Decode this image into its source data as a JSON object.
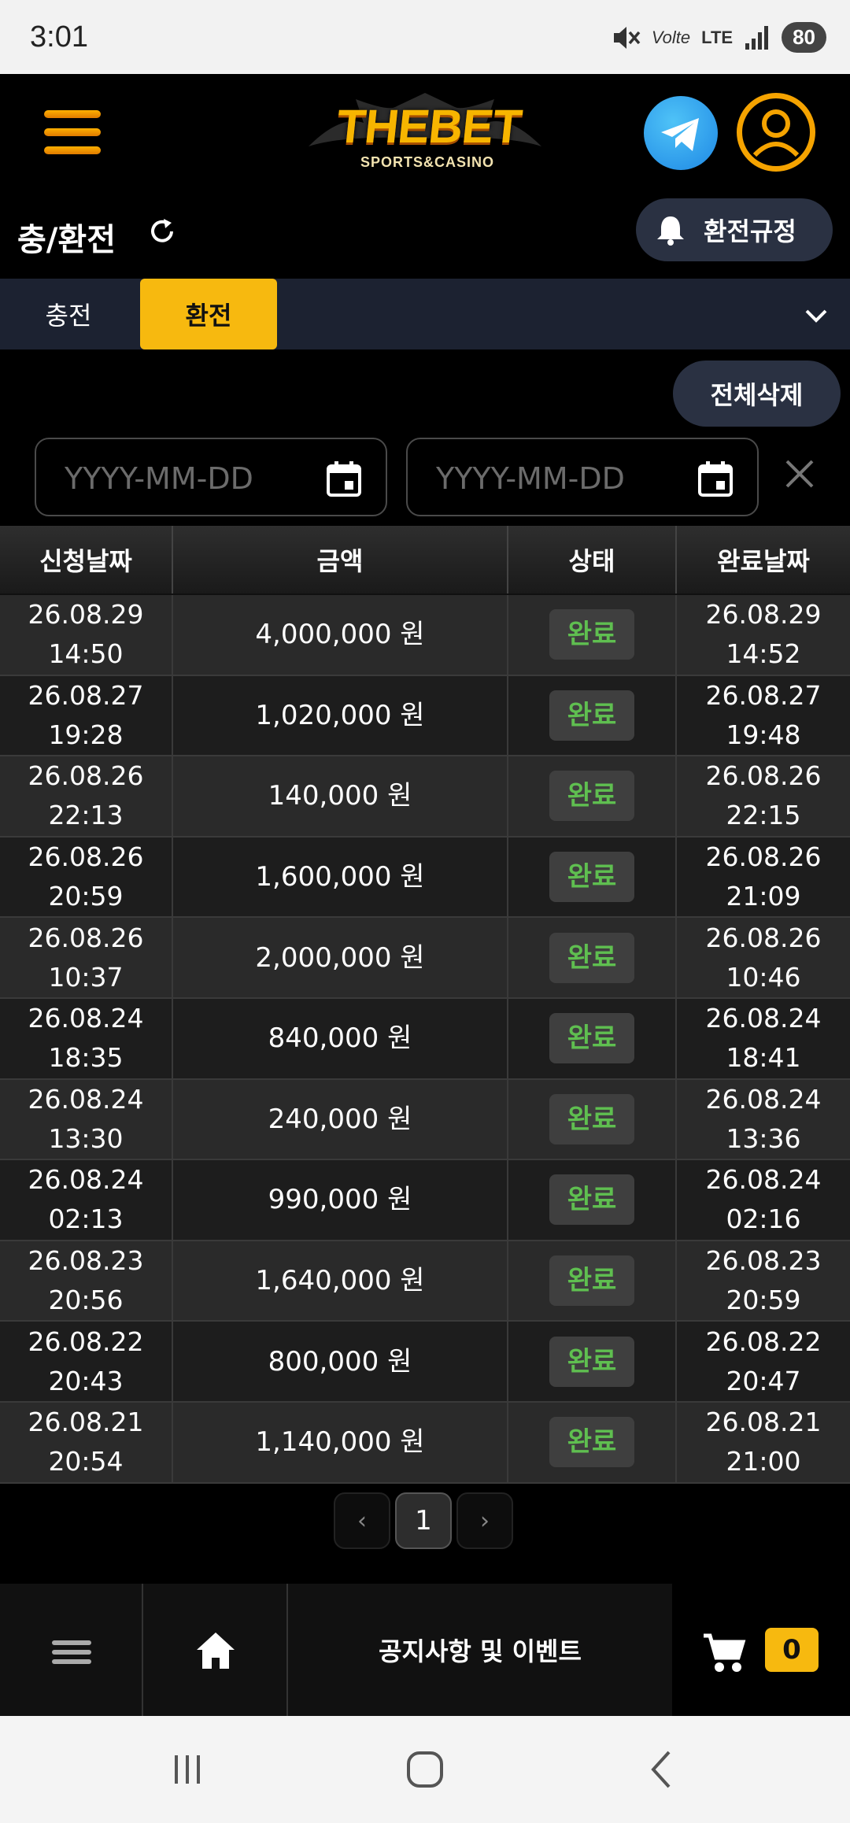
{
  "status_bar": {
    "time": "3:01",
    "network": "LTE",
    "volte": "Volte",
    "battery": "80"
  },
  "header": {
    "logo_text": "THEBET",
    "logo_sub": "SPORTS&CASINO"
  },
  "title_row": {
    "title": "충/환전",
    "rule_button": "환전규정"
  },
  "tabs": {
    "charge": "충전",
    "exchange": "환전"
  },
  "actions": {
    "delete_all": "전체삭제"
  },
  "filters": {
    "start_placeholder": "YYYY-MM-DD",
    "end_placeholder": "YYYY-MM-DD"
  },
  "table": {
    "headers": [
      "신청날짜",
      "금액",
      "상태",
      "완료날짜"
    ],
    "rows": [
      {
        "req_date": "26.08.29",
        "req_time": "14:50",
        "amount": "4,000,000 원",
        "status": "완료",
        "done_date": "26.08.29",
        "done_time": "14:52"
      },
      {
        "req_date": "26.08.27",
        "req_time": "19:28",
        "amount": "1,020,000 원",
        "status": "완료",
        "done_date": "26.08.27",
        "done_time": "19:48"
      },
      {
        "req_date": "26.08.26",
        "req_time": "22:13",
        "amount": "140,000 원",
        "status": "완료",
        "done_date": "26.08.26",
        "done_time": "22:15"
      },
      {
        "req_date": "26.08.26",
        "req_time": "20:59",
        "amount": "1,600,000 원",
        "status": "완료",
        "done_date": "26.08.26",
        "done_time": "21:09"
      },
      {
        "req_date": "26.08.26",
        "req_time": "10:37",
        "amount": "2,000,000 원",
        "status": "완료",
        "done_date": "26.08.26",
        "done_time": "10:46"
      },
      {
        "req_date": "26.08.24",
        "req_time": "18:35",
        "amount": "840,000 원",
        "status": "완료",
        "done_date": "26.08.24",
        "done_time": "18:41"
      },
      {
        "req_date": "26.08.24",
        "req_time": "13:30",
        "amount": "240,000 원",
        "status": "완료",
        "done_date": "26.08.24",
        "done_time": "13:36"
      },
      {
        "req_date": "26.08.24",
        "req_time": "02:13",
        "amount": "990,000 원",
        "status": "완료",
        "done_date": "26.08.24",
        "done_time": "02:16"
      },
      {
        "req_date": "26.08.23",
        "req_time": "20:56",
        "amount": "1,640,000 원",
        "status": "완료",
        "done_date": "26.08.23",
        "done_time": "20:59"
      },
      {
        "req_date": "26.08.22",
        "req_time": "20:43",
        "amount": "800,000 원",
        "status": "완료",
        "done_date": "26.08.22",
        "done_time": "20:47"
      },
      {
        "req_date": "26.08.21",
        "req_time": "20:54",
        "amount": "1,140,000 원",
        "status": "완료",
        "done_date": "26.08.21",
        "done_time": "21:00"
      }
    ]
  },
  "pagination": {
    "prev": "‹",
    "current": "1",
    "next": "›"
  },
  "bottom_nav": {
    "notice": "공지사항 및 이벤트",
    "cart_count": "0"
  },
  "colors": {
    "accent": "#f7b90f",
    "status_done": "#5fbf50",
    "pill_bg": "#2a3142",
    "tab_bar": "#1c2231"
  }
}
